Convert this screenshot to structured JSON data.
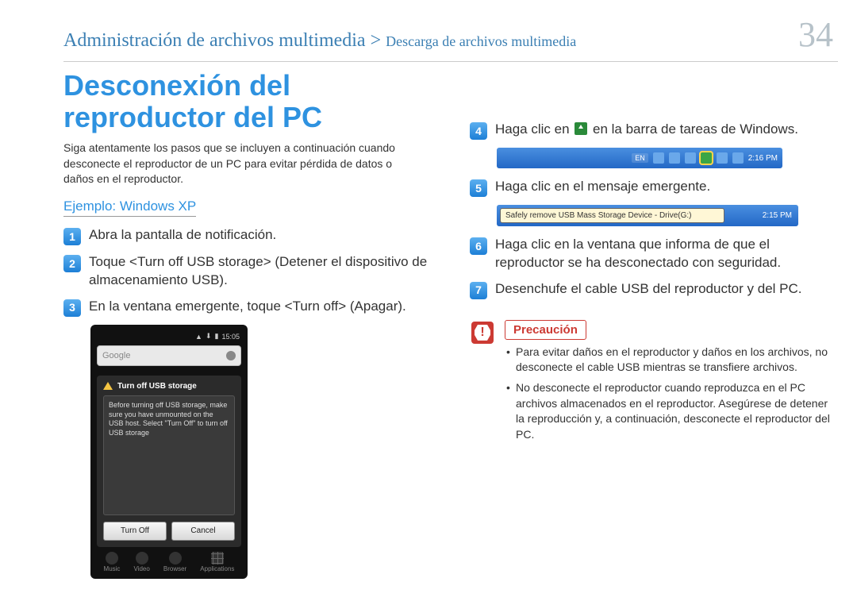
{
  "header": {
    "breadcrumb_main": "Administración de archivos multimedia",
    "breadcrumb_sep": " > ",
    "breadcrumb_sub": "Descarga de archivos multimedia",
    "page_number": "34"
  },
  "title": "Desconexión del reproductor del PC",
  "intro": "Siga atentamente los pasos que se incluyen a continuación cuando desconecte el reproductor de un PC para evitar pérdida de datos o daños en el reproductor.",
  "example_label": "Ejemplo: Windows XP",
  "steps_left": [
    {
      "n": "1",
      "text": "Abra la pantalla de notificación."
    },
    {
      "n": "2",
      "text": "Toque <Turn off USB storage> (Detener el dispositivo de almacenamiento USB)."
    },
    {
      "n": "3",
      "text": "En la ventana emergente, toque <Turn off> (Apagar)."
    }
  ],
  "steps_right": [
    {
      "n": "4",
      "pre": "Haga clic en ",
      "post": " en la barra de tareas de Windows."
    },
    {
      "n": "5",
      "text": "Haga clic en el mensaje emergente."
    },
    {
      "n": "6",
      "text": "Haga clic en la ventana que informa de que el reproductor se ha desconectado con seguridad."
    },
    {
      "n": "7",
      "text": "Desenchufe el cable USB del reproductor y del PC."
    }
  ],
  "taskbar": {
    "lang": "EN",
    "time": "2:16 PM"
  },
  "popup": {
    "balloon_text": "Safely remove USB Mass Storage Device - Drive(G:)",
    "time": "2:15 PM"
  },
  "phone": {
    "status_time": "15:05",
    "search_placeholder": "Google",
    "dialog_title": "Turn off USB storage",
    "dialog_body": "Before turning off USB storage, make sure you have unmounted on the USB host. Select \"Turn Off\" to turn off USB storage",
    "btn_turnoff": "Turn Off",
    "btn_cancel": "Cancel",
    "nav": [
      "Music",
      "Video",
      "Browser",
      "Applications"
    ]
  },
  "caution": {
    "title": "Precaución",
    "items": [
      "Para evitar daños en el reproductor y daños en los archivos, no desconecte el cable USB mientras se transfiere archivos.",
      "No desconecte el reproductor cuando reproduzca en el PC archivos almacenados en el reproductor. Asegúrese de detener la reproducción y, a continuación, desconecte el reproductor del PC."
    ]
  }
}
